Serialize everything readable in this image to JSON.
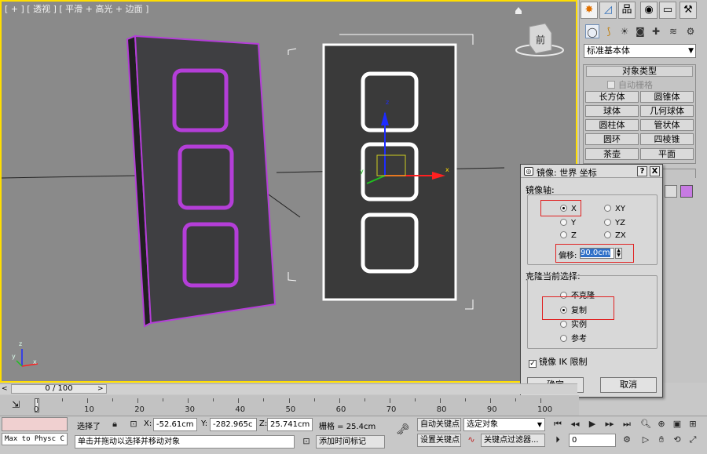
{
  "viewport": {
    "label": "[ + ] [ 透视 ] [ 平滑 + 高光 + 边面 ]",
    "viewcube_label": "前",
    "axis_labels": {
      "x": "x",
      "y": "y",
      "z": "z"
    }
  },
  "command_panel": {
    "dropdown_value": "标准基本体",
    "rollout_title": "对象类型",
    "autogrid_label": "自动栅格",
    "primitives": [
      "长方体",
      "圆锥体",
      "球体",
      "几何球体",
      "圆柱体",
      "管状体",
      "圆环",
      "四棱锥",
      "茶壶",
      "平面"
    ],
    "swatch_color": "#c77be3"
  },
  "mirror_dialog": {
    "title": "镜像: 世界 坐标",
    "help_button": "?",
    "close_button": "X",
    "axis_group_label": "镜像轴:",
    "axes": [
      "X",
      "Y",
      "Z",
      "XY",
      "YZ",
      "ZX"
    ],
    "axis_selected": "X",
    "offset_label": "偏移:",
    "offset_value": "90.0cm",
    "clone_group_label": "克隆当前选择:",
    "clone_options": [
      "不克隆",
      "复制",
      "实例",
      "参考"
    ],
    "clone_selected": "复制",
    "ik_label": "镜像 IK 限制",
    "ik_checked": true,
    "ok_label": "确定",
    "cancel_label": "取消"
  },
  "timeline": {
    "frame_display": "0 / 100",
    "tick_labels": [
      "0",
      "10",
      "20",
      "30",
      "40",
      "50",
      "60",
      "70",
      "80",
      "90",
      "100"
    ]
  },
  "status": {
    "script_field": "Max to Physc C",
    "selection_text": "选择了",
    "x_label": "X:",
    "x_value": "-52.61cm",
    "y_label": "Y:",
    "y_value": "-282.965c",
    "z_label": "Z:",
    "z_value": "25.741cm",
    "grid_text": "栅格 = 25.4cm",
    "autokey_label": "自动关键点",
    "selected_object_dropdown": "选定对象",
    "setkey_label": "设置关键点",
    "key_filter_label": "关键点过滤器...",
    "prompt_text": "单击并拖动以选择并移动对象",
    "add_time_tag": "添加时间标记",
    "current_frame": "0"
  }
}
